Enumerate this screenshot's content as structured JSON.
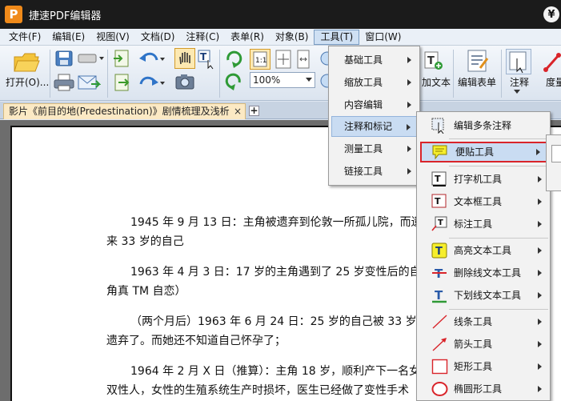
{
  "window": {
    "title": "捷速PDF编辑器",
    "logo_letter": "P",
    "yen": "¥"
  },
  "menubar": [
    "文件(F)",
    "编辑(E)",
    "视图(V)",
    "文档(D)",
    "注释(C)",
    "表单(R)",
    "对象(B)",
    "工具(T)",
    "窗口(W)"
  ],
  "toolbar": {
    "open_label": "打开(O)...",
    "zoom_value": "100%",
    "add_text_label": "加文本",
    "edit_form_label": "编辑表单",
    "annotate_label": "注释",
    "measure_label": "度量",
    "actual_size_label": "1:1"
  },
  "tab": {
    "title": "影片《前目的地(Predestination)》剧情梳理及浅析",
    "close": "×",
    "new": "+"
  },
  "document": {
    "paragraphs": [
      [
        "1945 年 9 月 13 日：主角被遗弃到伦敦一所孤儿院，而遗",
        "来 33 岁的自己"
      ],
      [
        "1963 年 4 月 3 日：17 岁的主角遇到了 25 岁变性后的自己",
        "角真 TM 自恋）"
      ],
      [
        "（两个月后）1963 年 6 月 24 日：25 岁的自己被 33 岁的",
        "遗弃了。而她还不知道自己怀孕了；"
      ],
      [
        "1964 年 2 月 X 日（推算）：主角 18 岁，顺利产下一名女",
        "双性人，女性的生殖系统生产时损坏，医生已经做了变性手术"
      ]
    ]
  },
  "tools_menu": {
    "items": [
      "基础工具",
      "缩放工具",
      "内容编辑",
      "注释和标记",
      "测量工具",
      "链接工具"
    ],
    "highlighted_index": 3
  },
  "annotation_menu": {
    "items": [
      {
        "label": "编辑多条注释",
        "icon": "edit-multiple-annotations-icon",
        "arrow": false
      },
      {
        "label": "便贴工具",
        "icon": "sticky-note-icon",
        "arrow": true
      },
      {
        "label": "打字机工具",
        "icon": "typewriter-icon",
        "arrow": true
      },
      {
        "label": "文本框工具",
        "icon": "textbox-icon",
        "arrow": true
      },
      {
        "label": "标注工具",
        "icon": "callout-icon",
        "arrow": true
      },
      {
        "label": "高亮文本工具",
        "icon": "highlight-text-icon",
        "arrow": true
      },
      {
        "label": "删除线文本工具",
        "icon": "strikethrough-text-icon",
        "arrow": true
      },
      {
        "label": "下划线文本工具",
        "icon": "underline-text-icon",
        "arrow": true
      },
      {
        "label": "线条工具",
        "icon": "line-icon",
        "arrow": true
      },
      {
        "label": "箭头工具",
        "icon": "arrow-icon",
        "arrow": true
      },
      {
        "label": "矩形工具",
        "icon": "rectangle-icon",
        "arrow": true
      },
      {
        "label": "椭圆形工具",
        "icon": "ellipse-icon",
        "arrow": true
      }
    ],
    "selected_index": 1
  },
  "colors": {
    "title_bar": "#1b1b1b",
    "logo": "#f08a1a",
    "selection_border": "#d9242a",
    "hover": "#c9dcf2",
    "tab": "#fbe9c4"
  }
}
